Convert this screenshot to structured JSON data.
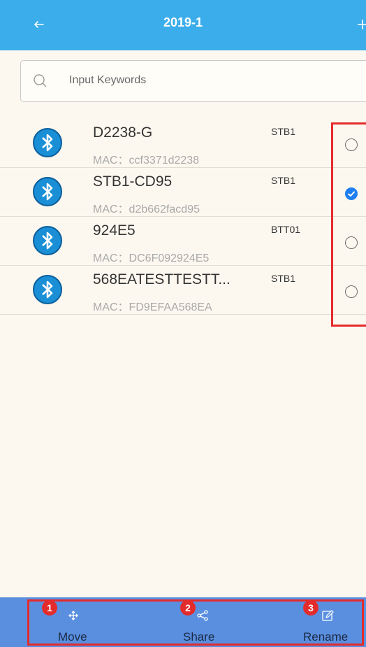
{
  "header": {
    "title": "2019-1",
    "back_icon": "arrow-left-icon",
    "add_icon": "plus-icon"
  },
  "search": {
    "placeholder": "Input Keywords",
    "icon": "search-icon"
  },
  "devices": [
    {
      "name": "D2238-G",
      "mac": "MAC：ccf3371d2238",
      "type": "STB1",
      "selected": false
    },
    {
      "name": "STB1-CD95",
      "mac": "MAC：d2b662facd95",
      "type": "STB1",
      "selected": true
    },
    {
      "name": "924E5",
      "mac": "MAC：DC6F092924E5",
      "type": "BTT01",
      "selected": false
    },
    {
      "name": "568EATESTTESTT...",
      "mac": "MAC：FD9EFAA568EA",
      "type": "STB1",
      "selected": false
    }
  ],
  "actions": [
    {
      "label": "Move",
      "badge": "1",
      "icon": "move-icon"
    },
    {
      "label": "Share",
      "badge": "2",
      "icon": "share-icon"
    },
    {
      "label": "Rename",
      "badge": "3",
      "icon": "edit-icon"
    }
  ],
  "colors": {
    "header": "#3badea",
    "background": "#fdf8ef",
    "bottom_bar": "#5a8fe0",
    "highlight": "#e42b2b",
    "radio_checked": "#1f7ff0"
  }
}
